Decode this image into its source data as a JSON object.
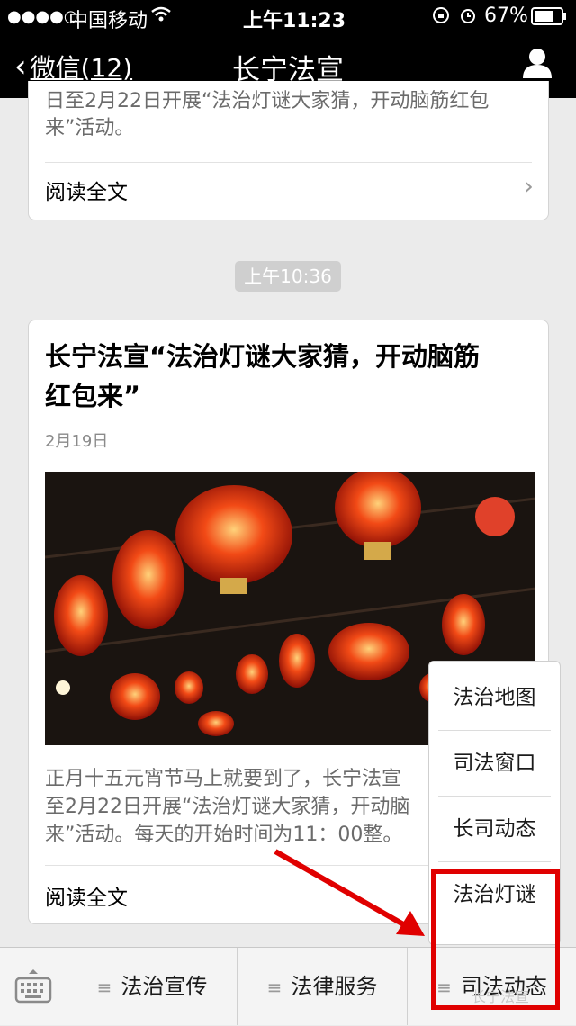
{
  "status_bar": {
    "signal": "●●●●○",
    "carrier": "中国移动",
    "time": "上午11:23",
    "battery": "67%"
  },
  "nav": {
    "back_label": "微信(12)",
    "title": "长宁法宣",
    "profile_icon": "person-icon"
  },
  "feed": {
    "card1": {
      "excerpt": "日至2月22日开展“法治灯谜大家猜，开动脑筋红包\n来”活动。",
      "read_more": "阅读全文"
    },
    "time_badge": "上午10:36",
    "card2": {
      "title": "长宁法宣“法治灯谜大家猜，开动脑筋\n红包来”",
      "date": "2月19日",
      "excerpt": "正月十五元宵节马上就要到了，长宁法宣\n至2月22日开展“法治灯谜大家猜，开动脑\n来”活动。每天的开始时间为11：00整。",
      "read_more": "阅读全文"
    }
  },
  "popup_menu": {
    "items": [
      "法治地图",
      "司法窗口",
      "长司动态",
      "法治灯谜"
    ]
  },
  "bottom_menu": {
    "keyboard_icon": "keyboard-icon",
    "items": [
      "法治宣传",
      "法律服务",
      "司法动态"
    ]
  },
  "watermark": "长宁法宣",
  "colors": {
    "highlight": "#e00000",
    "nav_bg": "#000000"
  }
}
